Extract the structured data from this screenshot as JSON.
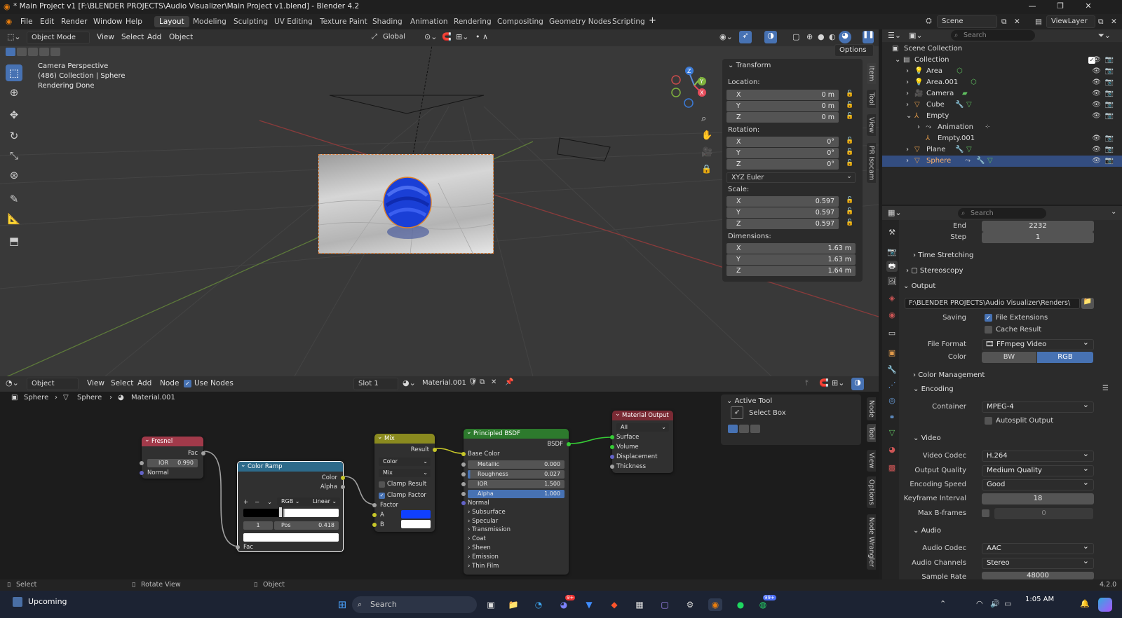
{
  "window": {
    "title": "* Main Project v1 [F:\\BLENDER PROJECTS\\Audio Visualizer\\Main Project v1.blend] - Blender 4.2"
  },
  "menu": [
    "File",
    "Edit",
    "Render",
    "Window",
    "Help"
  ],
  "workspaces": [
    "Layout",
    "Modeling",
    "Sculpting",
    "UV Editing",
    "Texture Paint",
    "Shading",
    "Animation",
    "Rendering",
    "Compositing",
    "Geometry Nodes",
    "Scripting"
  ],
  "scene": {
    "name": "Scene",
    "view_layer": "ViewLayer"
  },
  "viewport": {
    "mode": "Object Mode",
    "menus": [
      "View",
      "Select",
      "Add",
      "Object"
    ],
    "transform_orientation": "Global",
    "options": "Options",
    "info": {
      "line1": "Camera Perspective",
      "line2": "(486) Collection | Sphere",
      "line3": "Rendering Done"
    }
  },
  "npanel": {
    "title": "Transform",
    "location_label": "Location:",
    "location": [
      {
        "axis": "X",
        "value": "0 m"
      },
      {
        "axis": "Y",
        "value": "0 m"
      },
      {
        "axis": "Z",
        "value": "0 m"
      }
    ],
    "rotation_label": "Rotation:",
    "rotation": [
      {
        "axis": "X",
        "value": "0°"
      },
      {
        "axis": "Y",
        "value": "0°"
      },
      {
        "axis": "Z",
        "value": "0°"
      }
    ],
    "rotation_mode": "XYZ Euler",
    "scale_label": "Scale:",
    "scale": [
      {
        "axis": "X",
        "value": "0.597"
      },
      {
        "axis": "Y",
        "value": "0.597"
      },
      {
        "axis": "Z",
        "value": "0.597"
      }
    ],
    "dimensions_label": "Dimensions:",
    "dimensions": [
      {
        "axis": "X",
        "value": "1.63 m"
      },
      {
        "axis": "Y",
        "value": "1.63 m"
      },
      {
        "axis": "Z",
        "value": "1.64 m"
      }
    ],
    "tabs": [
      "Item",
      "Tool",
      "View",
      "PR Isocam"
    ]
  },
  "outliner": {
    "search_placeholder": "Search",
    "root": "Scene Collection",
    "collection": "Collection",
    "items": [
      "Area",
      "Area.001",
      "Camera",
      "Cube",
      "Empty",
      "Animation",
      "Empty.001",
      "Plane",
      "Sphere"
    ]
  },
  "properties": {
    "search_placeholder": "Search",
    "end_label": "End",
    "end_value": "2232",
    "step_label": "Step",
    "step_value": "1",
    "time_stretching": "Time Stretching",
    "stereoscopy": "Stereoscopy",
    "output_section": "Output",
    "output_path": "F:\\BLENDER PROJECTS\\Audio Visualizer\\Renders\\",
    "saving_label": "Saving",
    "file_extensions": "File Extensions",
    "cache_result": "Cache Result",
    "file_format_label": "File Format",
    "file_format": "FFmpeg Video",
    "color_label": "Color",
    "color_bw": "BW",
    "color_rgb": "RGB",
    "color_management": "Color Management",
    "encoding": "Encoding",
    "container_label": "Container",
    "container": "MPEG-4",
    "autosplit": "Autosplit Output",
    "video": "Video",
    "video_codec_label": "Video Codec",
    "video_codec": "H.264",
    "output_quality_label": "Output Quality",
    "output_quality": "Medium Quality",
    "encoding_speed_label": "Encoding Speed",
    "encoding_speed": "Good",
    "keyframe_label": "Keyframe Interval",
    "keyframe": "18",
    "max_bframes_label": "Max B-frames",
    "max_bframes": "0",
    "audio": "Audio",
    "audio_codec_label": "Audio Codec",
    "audio_codec": "AAC",
    "audio_channels_label": "Audio Channels",
    "audio_channels": "Stereo",
    "sample_rate_label": "Sample Rate",
    "sample_rate": "48000"
  },
  "node_editor": {
    "type": "Object",
    "menus": [
      "View",
      "Select",
      "Add",
      "Node"
    ],
    "use_nodes": "Use Nodes",
    "slot": "Slot 1",
    "material": "Material.001",
    "breadcrumb": [
      "Sphere",
      "Sphere",
      "Material.001"
    ],
    "fresnel": {
      "title": "Fresnel",
      "fac": "Fac",
      "ior_label": "IOR",
      "ior": "0.990",
      "normal": "Normal"
    },
    "color_ramp": {
      "title": "Color Ramp",
      "color": "Color",
      "alpha": "Alpha",
      "mode": "RGB",
      "interp": "Linear",
      "index": "1",
      "pos_label": "Pos",
      "pos": "0.418",
      "fac": "Fac"
    },
    "mix": {
      "title": "Mix",
      "result": "Result",
      "data_type": "Color",
      "blend": "Mix",
      "clamp_result": "Clamp Result",
      "clamp_factor": "Clamp Factor",
      "factor": "Factor",
      "a": "A",
      "b": "B"
    },
    "bsdf": {
      "title": "Principled BSDF",
      "out": "BSDF",
      "base_color": "Base Color",
      "metallic_label": "Metallic",
      "metallic": "0.000",
      "roughness_label": "Roughness",
      "roughness": "0.027",
      "ior_label": "IOR",
      "ior": "1.500",
      "alpha_label": "Alpha",
      "alpha": "1.000",
      "normal": "Normal",
      "panels": [
        "Subsurface",
        "Specular",
        "Transmission",
        "Coat",
        "Sheen",
        "Emission",
        "Thin Film"
      ]
    },
    "output": {
      "title": "Material Output",
      "target": "All",
      "inputs": [
        "Surface",
        "Volume",
        "Displacement",
        "Thickness"
      ]
    },
    "tabs": [
      "Node",
      "Tool",
      "View",
      "Options",
      "Node Wrangler"
    ]
  },
  "active_tool": {
    "title": "Active Tool",
    "tool": "Select Box"
  },
  "status": {
    "select": "Select",
    "rotate": "Rotate View",
    "object": "Object",
    "version": "4.2.0"
  },
  "taskbar": {
    "weather": "Upcoming",
    "search": "Search",
    "badge": "99+",
    "time": "1:05 AM"
  },
  "colors": {
    "accent": "#4772b3",
    "selected_row": "#334d80",
    "fresnel_header": "#a13a4a",
    "colorramp_header": "#2d6a8a",
    "mix_header": "#8a8a1f",
    "bsdf_header": "#2d7a2d",
    "output_header": "#7a2a34"
  }
}
